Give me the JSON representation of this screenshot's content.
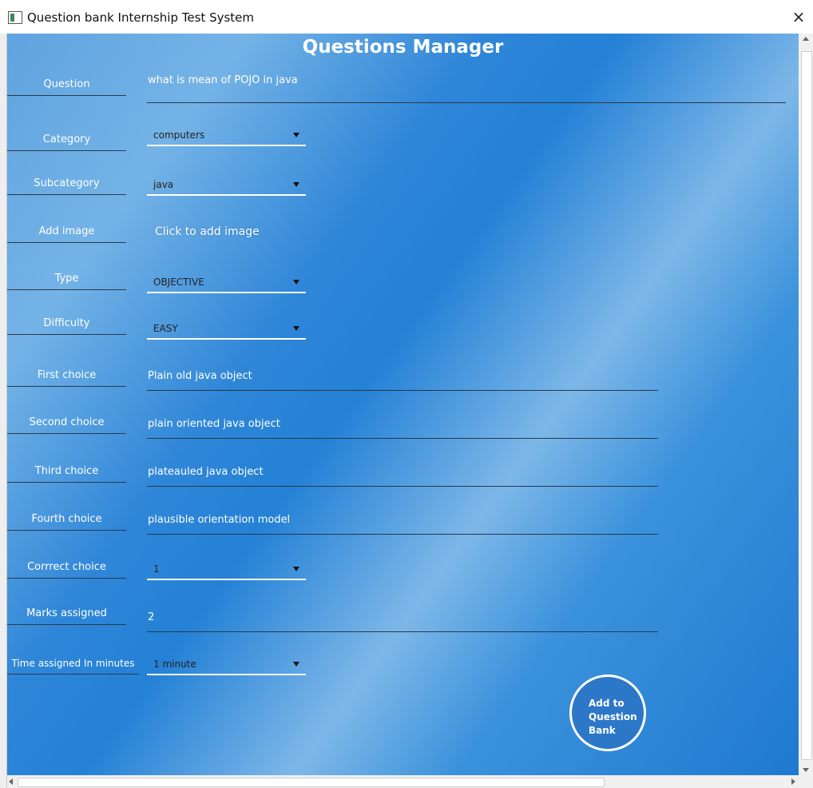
{
  "window": {
    "title": "Question bank Internship Test System",
    "close_glyph": "×"
  },
  "page_title": "Questions Manager",
  "form": {
    "question": {
      "label": "Question",
      "value": "what is mean of POJO in java"
    },
    "category": {
      "label": "Category",
      "value": "computers"
    },
    "subcategory": {
      "label": "Subcategory",
      "value": "java"
    },
    "add_image": {
      "label": "Add image",
      "action_text": "Click to add image"
    },
    "type": {
      "label": "Type",
      "value": "OBJECTIVE"
    },
    "difficulty": {
      "label": "Difficulty",
      "value": "EASY"
    },
    "first_choice": {
      "label": "First choice",
      "value": "Plain old java object"
    },
    "second_choice": {
      "label": "Second choice",
      "value": "plain oriented java object"
    },
    "third_choice": {
      "label": "Third choice",
      "value": "plateauled java object"
    },
    "fourth_choice": {
      "label": "Fourth choice",
      "value": "plausible orientation model"
    },
    "correct_choice": {
      "label": "Corrrect choice",
      "value": "1"
    },
    "marks": {
      "label": "Marks assigned",
      "value": "2"
    },
    "time": {
      "label": "Time assigned In minutes",
      "value": "1 minute"
    }
  },
  "submit_button": {
    "label": "Add to\nQuestion\nBank"
  },
  "colors": {
    "accent": "#2481d6",
    "button": "#2d77c8",
    "text": "#ffffff"
  }
}
